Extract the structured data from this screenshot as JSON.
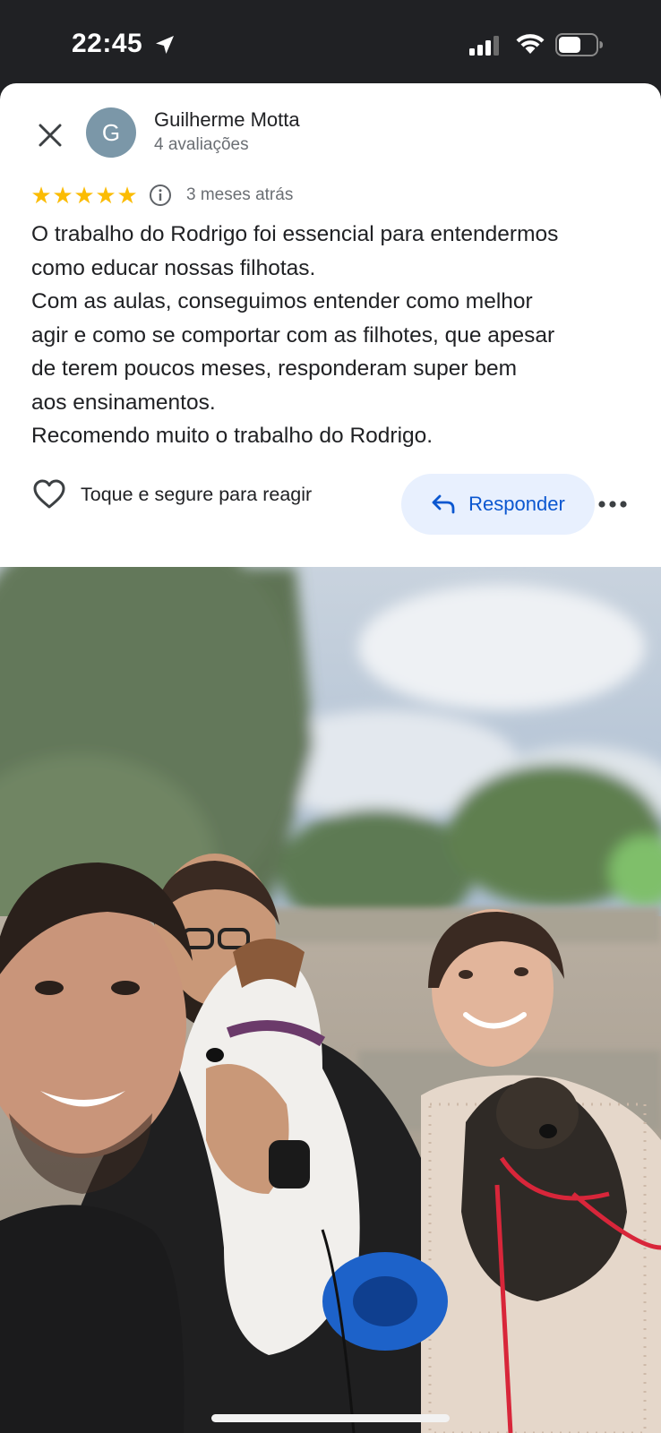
{
  "status_bar": {
    "time": "22:45",
    "icons": [
      "location-arrow-icon",
      "cellular-signal-icon",
      "wifi-icon",
      "battery-icon"
    ]
  },
  "review": {
    "author": {
      "avatar_letter": "G",
      "name": "Guilherme Motta",
      "meta": "4 avaliações"
    },
    "rating": 5,
    "rating_stars": [
      "★",
      "★",
      "★",
      "★",
      "★"
    ],
    "date": "3 meses atrás",
    "text_lines": [
      "O trabalho do Rodrigo foi essencial para entendermos",
      "como educar nossas filhotas.",
      "Com as aulas, conseguimos entender como melhor",
      "agir e como se comportar com as filhotes, que apesar",
      "de terem poucos meses, responderam super bem",
      "aos ensinamentos.",
      "Recomendo muito o trabalho do Rodrigo."
    ],
    "react_label": "Toque e segure para reagir",
    "reply_label": "Responder"
  },
  "colors": {
    "star": "#fbbc04",
    "reply_bg": "#e8f0fe",
    "reply_text": "#0b57d0",
    "avatar_bg": "#7b97a8",
    "status_bar_bg": "#202124"
  }
}
